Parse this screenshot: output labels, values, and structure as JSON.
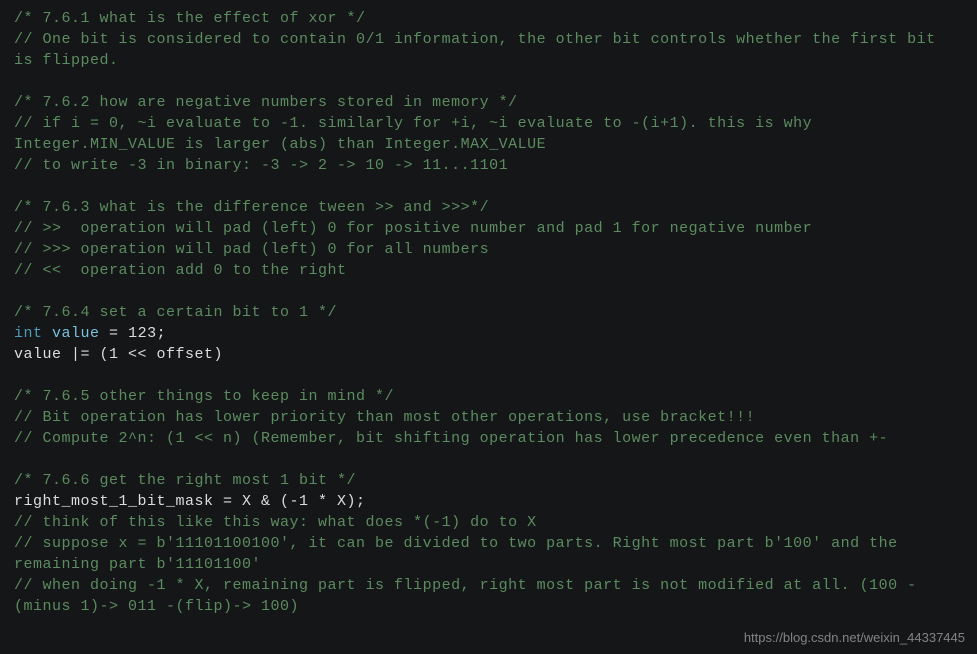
{
  "code": {
    "s761_title": "/* 7.6.1 what is the effect of xor */",
    "s761_c1": "// One bit is considered to contain 0/1 information, the other bit controls whether the first bit is flipped.",
    "s762_title": "/* 7.6.2 how are negative numbers stored in memory */",
    "s762_c1": "// if i = 0, ~i evaluate to -1. similarly for +i, ~i evaluate to -(i+1). this is why Integer.MIN_VALUE is larger (abs) than Integer.MAX_VALUE",
    "s762_c2": "// to write -3 in binary: -3 -> 2 -> 10 -> 11...1101",
    "s763_title": "/* 7.6.3 what is the difference tween >> and >>>*/",
    "s763_c1": "// >>  operation will pad (left) 0 for positive number and pad 1 for negative number",
    "s763_c2": "// >>> operation will pad (left) 0 for all numbers",
    "s763_c3": "// <<  operation add 0 to the right",
    "s764_title": "/* 7.6.4 set a certain bit to 1 */",
    "s764_kw": "int",
    "s764_var1": "value",
    "s764_eq": " = ",
    "s764_num": "123",
    "s764_semi": ";",
    "s764_line2_var": "value",
    "s764_line2_rest": " |= (1 << offset)",
    "s765_title": "/* 7.6.5 other things to keep in mind */",
    "s765_c1": "// Bit operation has lower priority than most other operations, use bracket!!!",
    "s765_c2": "// Compute 2^n: (1 << n) (Remember, bit shifting operation has lower precedence even than +-",
    "s766_title": "/* 7.6.6 get the right most 1 bit */",
    "s766_code": "right_most_1_bit_mask = X & (-1 * X);",
    "s766_c1": "// think of this like this way: what does *(-1) do to X",
    "s766_c2": "// suppose x = b'11101100100', it can be divided to two parts. Right most part b'100' and the remaining part b'11101100'",
    "s766_c3": "// when doing -1 * X, remaining part is flipped, right most part is not modified at all. (100 -(minus 1)-> 011 -(flip)-> 100)"
  },
  "watermark": "https://blog.csdn.net/weixin_44337445"
}
